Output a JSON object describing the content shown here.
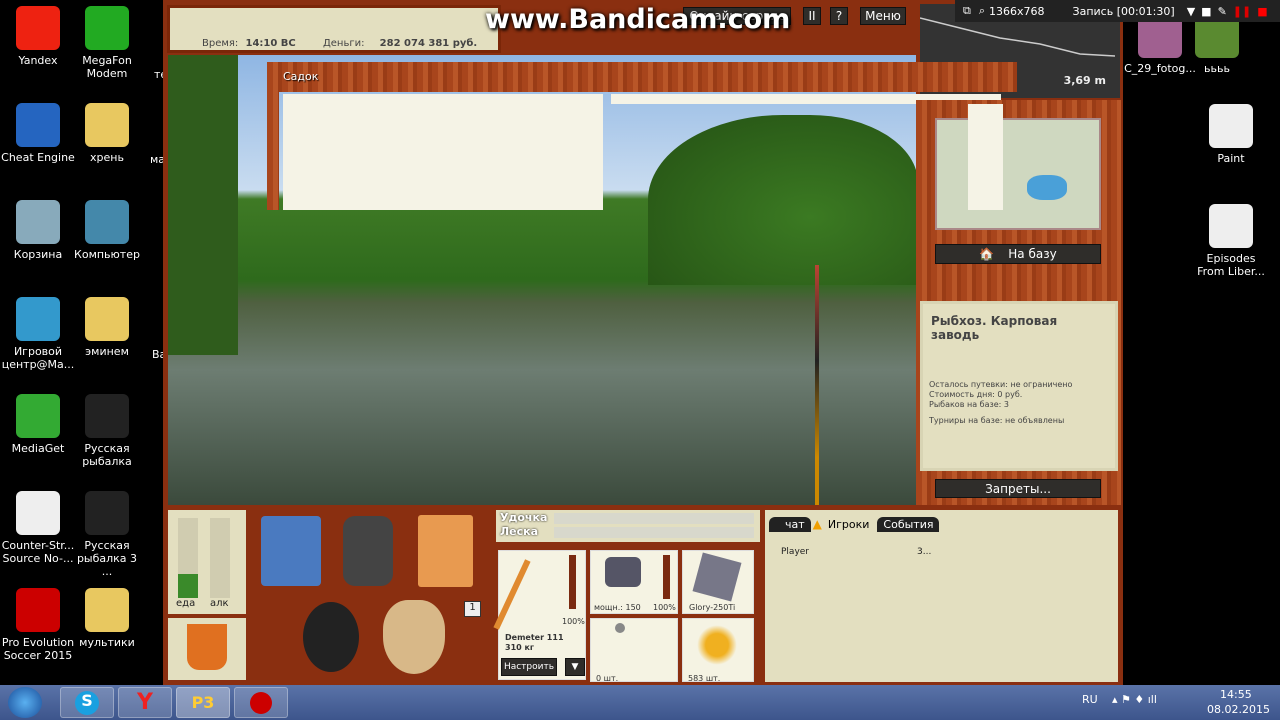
{
  "desktop_left": [
    {
      "label": "Yandex",
      "icon": "yandex-icon",
      "color": "#e21"
    },
    {
      "label": "MegaFon Modem",
      "icon": "megafon-icon",
      "color": "#2a2"
    },
    {
      "label": "Cheat Engine",
      "icon": "cheat-engine-icon",
      "color": "#2565c0"
    },
    {
      "label": "хрень",
      "icon": "folder-icon",
      "color": "#e8c860"
    },
    {
      "label": "Корзина",
      "icon": "recycle-bin-icon",
      "color": "#8ab"
    },
    {
      "label": "Компьютер",
      "icon": "computer-icon",
      "color": "#48a"
    },
    {
      "label": "Игровой центр@Ma...",
      "icon": "game-center-icon",
      "color": "#39c"
    },
    {
      "label": "эминем",
      "icon": "folder-icon",
      "color": "#e8c860"
    },
    {
      "label": "MediaGet",
      "icon": "mediaget-icon",
      "color": "#3a3"
    },
    {
      "label": "Русская рыбалка",
      "icon": "rr3-icon",
      "color": "#222"
    },
    {
      "label": "Counter-Str... Source No-...",
      "icon": "counter-strike-icon",
      "color": "#eee"
    },
    {
      "label": "Русская рыбалка 3 ...",
      "icon": "rr3-icon",
      "color": "#222"
    },
    {
      "label": "Pro Evolution Soccer 2015",
      "icon": "pes-icon",
      "color": "#c00"
    },
    {
      "label": "мультики",
      "icon": "folder-icon",
      "color": "#e8c860"
    }
  ],
  "desktop_partial": [
    "те",
    "ма",
    "Ва"
  ],
  "desktop_right": [
    {
      "label": "C_29_fotog...",
      "icon": "photo-icon",
      "color": "#a06090"
    },
    {
      "label": "ьььь",
      "icon": "minecraft-icon",
      "color": "#5a8a30"
    },
    {
      "label": "Paint",
      "icon": "paint-icon",
      "color": "#eee"
    },
    {
      "label": "Episodes From Liber...",
      "icon": "gta-icon",
      "color": "#eee"
    }
  ],
  "game": {
    "time_label": "Время:",
    "time": "14:10 ВС",
    "money_label": "Деньги:",
    "money": "282 074 381 руб.",
    "online_button": "Онлайн-сервис",
    "pause_button": "II",
    "help_button": "?",
    "menu_button": "Меню",
    "depth": "3,69 m",
    "keepnet_title": "Садок",
    "to_base_button": "На базу",
    "location_title": "Рыбхоз. Карповая заводь",
    "info": [
      "Осталось путевки: не ограничено",
      "Стоимость дня: 0 руб.",
      "Рыбаков на базе: 3"
    ],
    "tournaments": "Турниры на базе: не объявлены",
    "bans_button": "Запреты...",
    "food_label": "еда",
    "alcohol_label": "алк",
    "food_level": 0.3,
    "alcohol_level": 0,
    "count_badge": "1",
    "rod_label": "Удочка",
    "line_label": "Леска",
    "rod_name": "Demeter 111",
    "rod_weight": "310 кг",
    "rod_pct": "100%",
    "reel_power": "мощн.: 150",
    "reel_pct": "100%",
    "line_name": "Glory-250Ti",
    "hook_count": "0 шт.",
    "bait_count": "583 шт.",
    "setup_button": "Настроить",
    "dropdown_button": "▼",
    "tabs": [
      "чат",
      "Игроки",
      "События"
    ],
    "players": [
      {
        "name": "Player",
        "value": "3..."
      }
    ]
  },
  "bandicam": {
    "watermark": "www.Bandicam.com",
    "resolution": "1366x768",
    "recording": "Запись [00:01:30]"
  },
  "taskbar": {
    "lang": "RU",
    "time": "14:55",
    "date": "08.02.2015",
    "apps": [
      "windows-start",
      "skype",
      "yandex-browser",
      "rr3",
      "bandicam"
    ]
  }
}
